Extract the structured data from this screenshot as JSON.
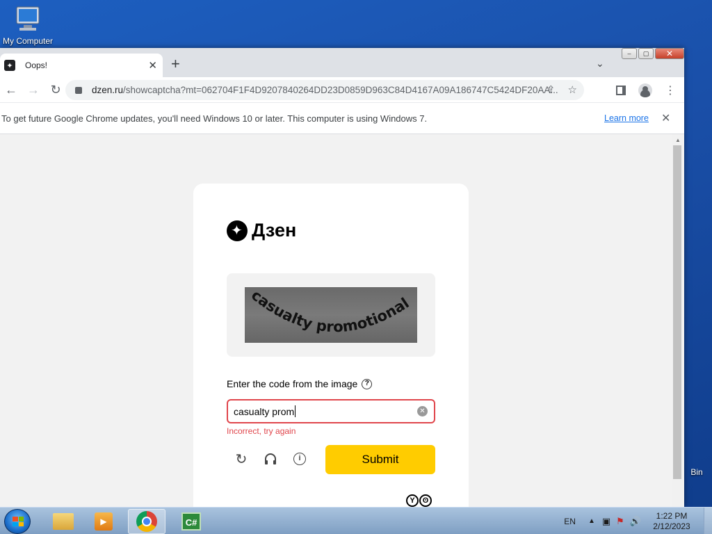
{
  "desktop": {
    "icons": [
      {
        "label": "My Computer"
      },
      {
        "label": "Bin"
      }
    ]
  },
  "browser": {
    "tab": {
      "title": "Oops!"
    },
    "address": {
      "host": "dzen.ru",
      "path": "/showcaptcha?mt=062704F1F4D9207840264DD23D0859D963C84D4167A09A186747C5424DF20AA..."
    },
    "infobar": {
      "message": "To get future Google Chrome updates, you'll need Windows 10 or later. This computer is using Windows 7.",
      "learn_more": "Learn more"
    }
  },
  "page": {
    "logo_text": "Дзен",
    "captcha_text": "casualty promotional",
    "prompt": "Enter the code from the image",
    "input_value": "casualty prom",
    "error": "Incorrect, try again",
    "submit_label": "Submit",
    "brand_glyphs": [
      "Y",
      "ʘ"
    ]
  },
  "taskbar": {
    "language": "EN",
    "time": "1:22 PM",
    "date": "2/12/2023",
    "apps": [
      "explorer",
      "media-player",
      "chrome",
      "csharp"
    ]
  }
}
